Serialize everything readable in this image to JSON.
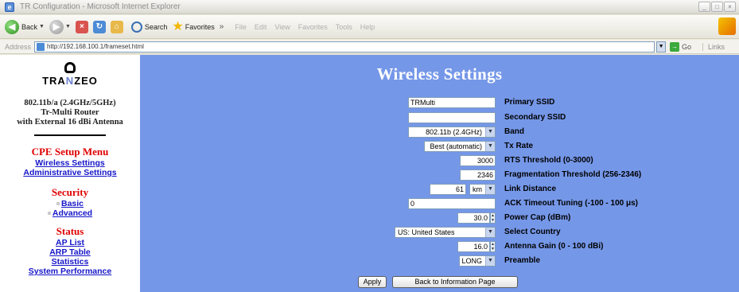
{
  "window": {
    "title": "TR Configuration - Microsoft Internet Explorer"
  },
  "toolbar": {
    "back_label": "Back",
    "search_label": "Search",
    "favorites_label": "Favorites",
    "menu_items": [
      "File",
      "Edit",
      "View",
      "Favorites",
      "Tools",
      "Help"
    ]
  },
  "address": {
    "label": "Address",
    "url": "http://192.168.100.1/frameset.html",
    "go_label": "Go",
    "links_label": "Links"
  },
  "sidebar": {
    "logo_text_left": "TRA",
    "logo_text_mid": "N",
    "logo_text_right": "ZEO",
    "product_line1": "802.11b/a (2.4GHz/5GHz)",
    "product_line2": "Tr-Multi Router",
    "product_line3": "with External 16 dBi Antenna",
    "cpe_title": "CPE Setup Menu",
    "wireless_settings": "Wireless Settings",
    "administrative_settings": "Administrative Settings",
    "security_title": "Security",
    "basic": "Basic",
    "advanced": "Advanced",
    "status_title": "Status",
    "ap_list": "AP List",
    "arp_table": "ARP Table",
    "statistics": "Statistics",
    "system_performance": "System Performance"
  },
  "main": {
    "title": "Wireless Settings",
    "primary_ssid": {
      "label": "Primary SSID",
      "value": "TRMulti"
    },
    "secondary_ssid": {
      "label": "Secondary SSID",
      "value": ""
    },
    "band": {
      "label": "Band",
      "value": "802.11b (2.4GHz)"
    },
    "tx_rate": {
      "label": "Tx Rate",
      "value": "Best (automatic)"
    },
    "rts_threshold": {
      "label": "RTS Threshold (0-3000)",
      "value": "3000"
    },
    "frag_threshold": {
      "label": "Fragmentation Threshold (256-2346)",
      "value": "2346"
    },
    "link_distance": {
      "label": "Link Distance",
      "value": "61",
      "unit": "km"
    },
    "ack_timeout": {
      "label": "ACK Timeout Tuning (-100 - 100 μs)",
      "value": "0"
    },
    "power_cap": {
      "label": "Power Cap (dBm)",
      "value": "30.0"
    },
    "country": {
      "label": "Select Country",
      "value": "US: United States"
    },
    "antenna_gain": {
      "label": "Antenna Gain (0 - 100 dBi)",
      "value": "16.0"
    },
    "preamble": {
      "label": "Preamble",
      "value": "LONG"
    },
    "apply_label": "Apply",
    "back_info_label": "Back to Information Page"
  },
  "colors": {
    "page_bg": "#7597e8",
    "menu_red": "#e00000",
    "link_blue": "#1515c9"
  }
}
